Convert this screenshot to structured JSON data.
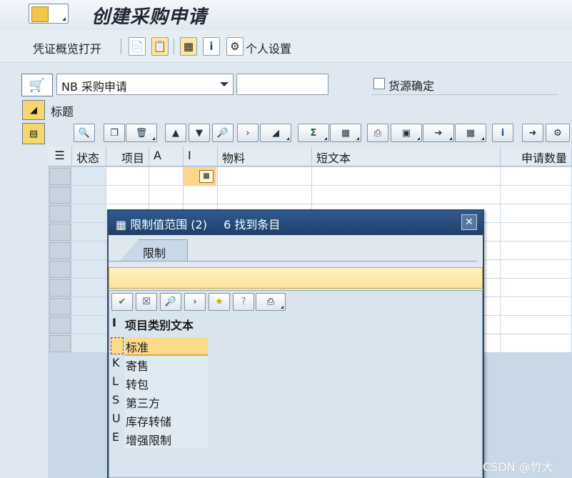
{
  "window": {
    "title": "创建采购申请"
  },
  "toolbar": {
    "overview_label": "凭证概览打开",
    "personal_settings_label": "个人设置",
    "icons": [
      "new-document-icon",
      "copy-document-icon",
      "hierarchy-icon",
      "info-icon",
      "personal-settings-icon"
    ]
  },
  "header": {
    "doc_type_value": "NB 采购申请",
    "doc_number_value": "",
    "source_determination_label": "货源确定",
    "source_determination_checked": false,
    "header_label": "标题"
  },
  "grid": {
    "columns": [
      "状态",
      "项目",
      "A",
      "I",
      "物料",
      "短文本",
      "申请数量"
    ],
    "visible_rows": 10
  },
  "dialog": {
    "title_left": "限制值范围 (2)",
    "title_right": "6 找到条目",
    "tab_label": "限制",
    "list_header_code": "I",
    "list_header_text": "项目类别文本",
    "items": [
      {
        "code": "",
        "text": "标准"
      },
      {
        "code": "K",
        "text": "寄售"
      },
      {
        "code": "L",
        "text": "转包"
      },
      {
        "code": "S",
        "text": "第三方"
      },
      {
        "code": "U",
        "text": "库存转储"
      },
      {
        "code": "E",
        "text": "增强限制"
      }
    ],
    "selected_index": 0
  },
  "watermark": "CSDN @竹大",
  "colors": {
    "dialog_title": "#1f3f68",
    "selection": "#fdd98a",
    "message_bar": "#fde29a"
  }
}
